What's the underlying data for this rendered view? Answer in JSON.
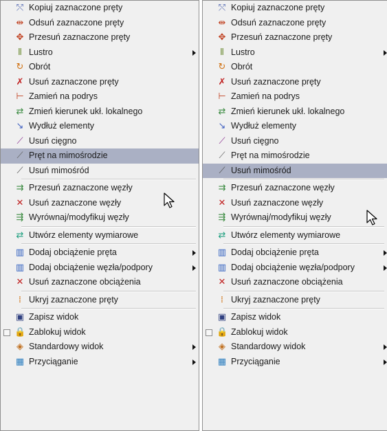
{
  "menus": [
    {
      "items": [
        {
          "type": "item",
          "icon": "copy-bars-icon",
          "glyph": "⤲",
          "color": "#5a6fb5",
          "label": "Kopiuj zaznaczone pręty"
        },
        {
          "type": "item",
          "icon": "move-apart-bars-icon",
          "glyph": "⇹",
          "color": "#c04020",
          "label": "Odsuń zaznaczone pręty"
        },
        {
          "type": "item",
          "icon": "move-bars-icon",
          "glyph": "✥",
          "color": "#c04020",
          "label": "Przesuń zaznaczone pręty"
        },
        {
          "type": "item",
          "icon": "mirror-icon",
          "glyph": "⫴",
          "color": "#6a8a30",
          "label": "Lustro",
          "submenu": true
        },
        {
          "type": "item",
          "icon": "rotate-icon",
          "glyph": "↻",
          "color": "#d07010",
          "label": "Obrót"
        },
        {
          "type": "item",
          "icon": "delete-bars-icon",
          "glyph": "✗",
          "color": "#c02020",
          "label": "Usuń zaznaczone pręty"
        },
        {
          "type": "item",
          "icon": "replace-support-icon",
          "glyph": "⊢",
          "color": "#c04020",
          "label": "Zamień na podrys"
        },
        {
          "type": "item",
          "icon": "change-direction-icon",
          "glyph": "⇄",
          "color": "#3a8a40",
          "label": "Zmień kierunek ukł. lokalnego"
        },
        {
          "type": "item",
          "icon": "extend-elements-icon",
          "glyph": "↘",
          "color": "#4060c0",
          "label": "Wydłuż elementy"
        },
        {
          "type": "item",
          "icon": "delete-tendon-icon",
          "glyph": "⟋",
          "color": "#8a3090",
          "label": "Usuń cięgno"
        },
        {
          "type": "item",
          "icon": "eccentric-bar-icon",
          "glyph": "⟋",
          "color": "#606060",
          "label": "Pręt na mimośrodzie",
          "highlight": true
        },
        {
          "type": "item",
          "icon": "delete-eccentricity-icon",
          "glyph": "⟋",
          "color": "#505050",
          "label": "Usuń mimośród"
        },
        {
          "type": "sep"
        },
        {
          "type": "item",
          "icon": "move-nodes-icon",
          "glyph": "⇉",
          "color": "#3a8a40",
          "label": "Przesuń zaznaczone węzły"
        },
        {
          "type": "item",
          "icon": "delete-nodes-icon",
          "glyph": "✕",
          "color": "#c02020",
          "label": "Usuń zaznaczone węzły"
        },
        {
          "type": "item",
          "icon": "align-nodes-icon",
          "glyph": "⇶",
          "color": "#3a8a40",
          "label": "Wyrównaj/modyfikuj węzły"
        },
        {
          "type": "sep"
        },
        {
          "type": "item",
          "icon": "dimension-elements-icon",
          "glyph": "⇄",
          "color": "#20a080",
          "label": "Utwórz elementy wymiarowe"
        },
        {
          "type": "sep"
        },
        {
          "type": "item",
          "icon": "bar-load-icon",
          "glyph": "▥",
          "color": "#3060c0",
          "label": "Dodaj obciążenie pręta",
          "submenu": true
        },
        {
          "type": "item",
          "icon": "node-load-icon",
          "glyph": "▥",
          "color": "#3060c0",
          "label": "Dodaj obciążenie węzła/podpory",
          "submenu": true
        },
        {
          "type": "item",
          "icon": "delete-loads-icon",
          "glyph": "✕",
          "color": "#c02020",
          "label": "Usuń zaznaczone obciążenia"
        },
        {
          "type": "sep"
        },
        {
          "type": "item",
          "icon": "hide-bars-icon",
          "glyph": "⁞",
          "color": "#d07010",
          "label": "Ukryj zaznaczone pręty"
        },
        {
          "type": "sep"
        },
        {
          "type": "item",
          "icon": "save-view-icon",
          "glyph": "▣",
          "color": "#304080",
          "label": "Zapisz widok"
        },
        {
          "type": "item",
          "icon": "lock-view-icon",
          "glyph": "🔒",
          "color": "#909090",
          "label": "Zablokuj widok",
          "checkbox": true
        },
        {
          "type": "item",
          "icon": "standard-view-icon",
          "glyph": "◈",
          "color": "#c07020",
          "label": "Standardowy widok",
          "submenu": true
        },
        {
          "type": "item",
          "icon": "snap-icon",
          "glyph": "▦",
          "color": "#3080c0",
          "label": "Przyciąganie",
          "submenu": true
        }
      ]
    },
    {
      "items": [
        {
          "type": "item",
          "icon": "copy-bars-icon",
          "glyph": "⤲",
          "color": "#5a6fb5",
          "label": "Kopiuj zaznaczone pręty"
        },
        {
          "type": "item",
          "icon": "move-apart-bars-icon",
          "glyph": "⇹",
          "color": "#c04020",
          "label": "Odsuń zaznaczone pręty"
        },
        {
          "type": "item",
          "icon": "move-bars-icon",
          "glyph": "✥",
          "color": "#c04020",
          "label": "Przesuń zaznaczone pręty"
        },
        {
          "type": "item",
          "icon": "mirror-icon",
          "glyph": "⫴",
          "color": "#6a8a30",
          "label": "Lustro",
          "submenu": true
        },
        {
          "type": "item",
          "icon": "rotate-icon",
          "glyph": "↻",
          "color": "#d07010",
          "label": "Obrót"
        },
        {
          "type": "item",
          "icon": "delete-bars-icon",
          "glyph": "✗",
          "color": "#c02020",
          "label": "Usuń zaznaczone pręty"
        },
        {
          "type": "item",
          "icon": "replace-support-icon",
          "glyph": "⊢",
          "color": "#c04020",
          "label": "Zamień na podrys"
        },
        {
          "type": "item",
          "icon": "change-direction-icon",
          "glyph": "⇄",
          "color": "#3a8a40",
          "label": "Zmień kierunek ukł. lokalnego"
        },
        {
          "type": "item",
          "icon": "extend-elements-icon",
          "glyph": "↘",
          "color": "#4060c0",
          "label": "Wydłuż elementy"
        },
        {
          "type": "item",
          "icon": "delete-tendon-icon",
          "glyph": "⟋",
          "color": "#8a3090",
          "label": "Usuń cięgno"
        },
        {
          "type": "item",
          "icon": "eccentric-bar-icon",
          "glyph": "⟋",
          "color": "#606060",
          "label": "Pręt na mimośrodzie"
        },
        {
          "type": "item",
          "icon": "delete-eccentricity-icon",
          "glyph": "⟋",
          "color": "#505050",
          "label": "Usuń mimośród",
          "highlight": true
        },
        {
          "type": "sep"
        },
        {
          "type": "item",
          "icon": "move-nodes-icon",
          "glyph": "⇉",
          "color": "#3a8a40",
          "label": "Przesuń zaznaczone węzły"
        },
        {
          "type": "item",
          "icon": "delete-nodes-icon",
          "glyph": "✕",
          "color": "#c02020",
          "label": "Usuń zaznaczone węzły"
        },
        {
          "type": "item",
          "icon": "align-nodes-icon",
          "glyph": "⇶",
          "color": "#3a8a40",
          "label": "Wyrównaj/modyfikuj węzły"
        },
        {
          "type": "sep"
        },
        {
          "type": "item",
          "icon": "dimension-elements-icon",
          "glyph": "⇄",
          "color": "#20a080",
          "label": "Utwórz elementy wymiarowe"
        },
        {
          "type": "sep"
        },
        {
          "type": "item",
          "icon": "bar-load-icon",
          "glyph": "▥",
          "color": "#3060c0",
          "label": "Dodaj obciążenie pręta",
          "submenu": true
        },
        {
          "type": "item",
          "icon": "node-load-icon",
          "glyph": "▥",
          "color": "#3060c0",
          "label": "Dodaj obciążenie węzła/podpory",
          "submenu": true
        },
        {
          "type": "item",
          "icon": "delete-loads-icon",
          "glyph": "✕",
          "color": "#c02020",
          "label": "Usuń zaznaczone obciążenia"
        },
        {
          "type": "sep"
        },
        {
          "type": "item",
          "icon": "hide-bars-icon",
          "glyph": "⁞",
          "color": "#d07010",
          "label": "Ukryj zaznaczone pręty"
        },
        {
          "type": "sep"
        },
        {
          "type": "item",
          "icon": "save-view-icon",
          "glyph": "▣",
          "color": "#304080",
          "label": "Zapisz widok"
        },
        {
          "type": "item",
          "icon": "lock-view-icon",
          "glyph": "🔒",
          "color": "#909090",
          "label": "Zablokuj widok",
          "checkbox": true
        },
        {
          "type": "item",
          "icon": "standard-view-icon",
          "glyph": "◈",
          "color": "#c07020",
          "label": "Standardowy widok",
          "submenu": true
        },
        {
          "type": "item",
          "icon": "snap-icon",
          "glyph": "▦",
          "color": "#3080c0",
          "label": "Przyciąganie",
          "submenu": true
        }
      ]
    }
  ],
  "colors": {
    "highlight": "#aab0c4",
    "menu_bg": "#f0f0f0",
    "border": "#8e8e8e"
  }
}
